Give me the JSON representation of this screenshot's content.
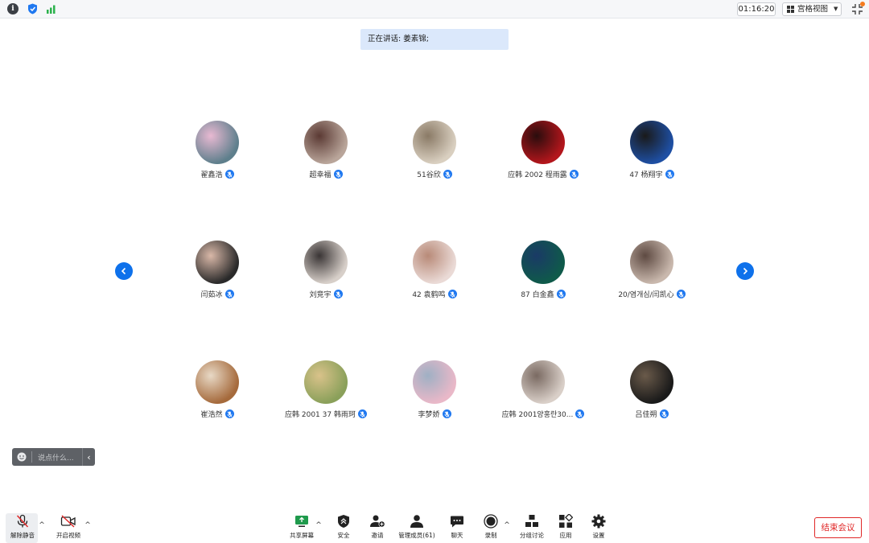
{
  "topbar": {
    "timer": "01:16:20",
    "view_label": "宫格视图"
  },
  "speaking_banner": "正在讲话: 姜素锦;",
  "participants": [
    {
      "name": "翟鑫浩",
      "c1": "#5e7f8c",
      "c2": "#e8b9d2"
    },
    {
      "name": "超幸福",
      "c1": "#b9a59a",
      "c2": "#5b3a34"
    },
    {
      "name": "51谷欣",
      "c1": "#d9cfc0",
      "c2": "#8a7a66"
    },
    {
      "name": "应韩 2002 程雨露",
      "c1": "#b3161c",
      "c2": "#2a0d0d"
    },
    {
      "name": "47 杨翔宇",
      "c1": "#1e4fa3",
      "c2": "#1a1a1a"
    },
    {
      "name": "闫茹冰",
      "c1": "#2a2a2a",
      "c2": "#d9b8a8"
    },
    {
      "name": "刘竞宇",
      "c1": "#d7cfc9",
      "c2": "#3a3535"
    },
    {
      "name": "42 袁鹤鸣",
      "c1": "#eadad6",
      "c2": "#b88a78"
    },
    {
      "name": "87 白金鑫",
      "c1": "#0f5a4a",
      "c2": "#1a3a66"
    },
    {
      "name": "20/염개심/闫凯心",
      "c1": "#c9b8ad",
      "c2": "#5e4a42"
    },
    {
      "name": "崔浩然",
      "c1": "#a56a3c",
      "c2": "#e8d9c6"
    },
    {
      "name": "应韩 2001  37 韩雨珂",
      "c1": "#8aa05a",
      "c2": "#d9c28a"
    },
    {
      "name": "李梦娇",
      "c1": "#e9b8c8",
      "c2": "#9fb0c4"
    },
    {
      "name": "应韩 2001양홍란30...",
      "c1": "#d9cfc8",
      "c2": "#7a6a62"
    },
    {
      "name": "吕佳朔",
      "c1": "#1a1a1a",
      "c2": "#6a5a4a"
    }
  ],
  "chat": {
    "placeholder": "说点什么..."
  },
  "toolbar": {
    "unmute": "解除静音",
    "start_video": "开启视频",
    "share_screen": "共享屏幕",
    "security": "安全",
    "invite": "邀请",
    "manage_members": "管理成员(61)",
    "chat": "聊天",
    "record": "录制",
    "breakout": "分组讨论",
    "apps": "应用",
    "settings": "设置",
    "end_meeting": "结束会议"
  },
  "colors": {
    "accent": "#0e71eb",
    "end_red": "#e02828",
    "banner_bg": "#dbe8fb"
  }
}
